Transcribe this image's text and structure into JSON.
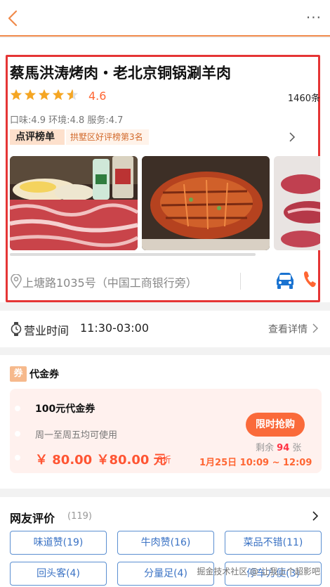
{
  "nav": {
    "more_label": "···"
  },
  "shop": {
    "name": "蔡馬洪涛烤肉・老北京铜锅涮羊肉",
    "rating": "4.6",
    "review_count": "1460条",
    "scores": "口味:4.9 环境:4.8 服务:4.7",
    "rank_tag": "点评榜单",
    "rank_desc": "拱墅区好评榜第3名",
    "address": "上塘路1035号（中国工商银行旁）",
    "star_color": "#f5a623",
    "accent_color": "#ff6633"
  },
  "hours": {
    "label": "营业时间",
    "value": "11:30-03:00",
    "detail": "查看详情"
  },
  "voucher_section": {
    "badge": "券",
    "title": "代金券",
    "name": "100元代金券",
    "condition": "周一至周五均可使用",
    "price": "￥ 80.00 ￥80.00 元",
    "discount": "8折",
    "button": "限时抢购",
    "remain_prefix": "剩余",
    "remain_count": "94",
    "remain_suffix": "张",
    "time": "1月25日 10:09 ~ 12:09"
  },
  "reviews": {
    "title": "网友评价",
    "count": "(119)",
    "tags": [
      "味道赞(19)",
      "牛肉赞(16)",
      "菜品不错(11)",
      "回头客(4)",
      "分量足(4)",
      "停车方便(3)"
    ]
  },
  "watermark": "掘金技术社区 @ 让我上个超影吧"
}
